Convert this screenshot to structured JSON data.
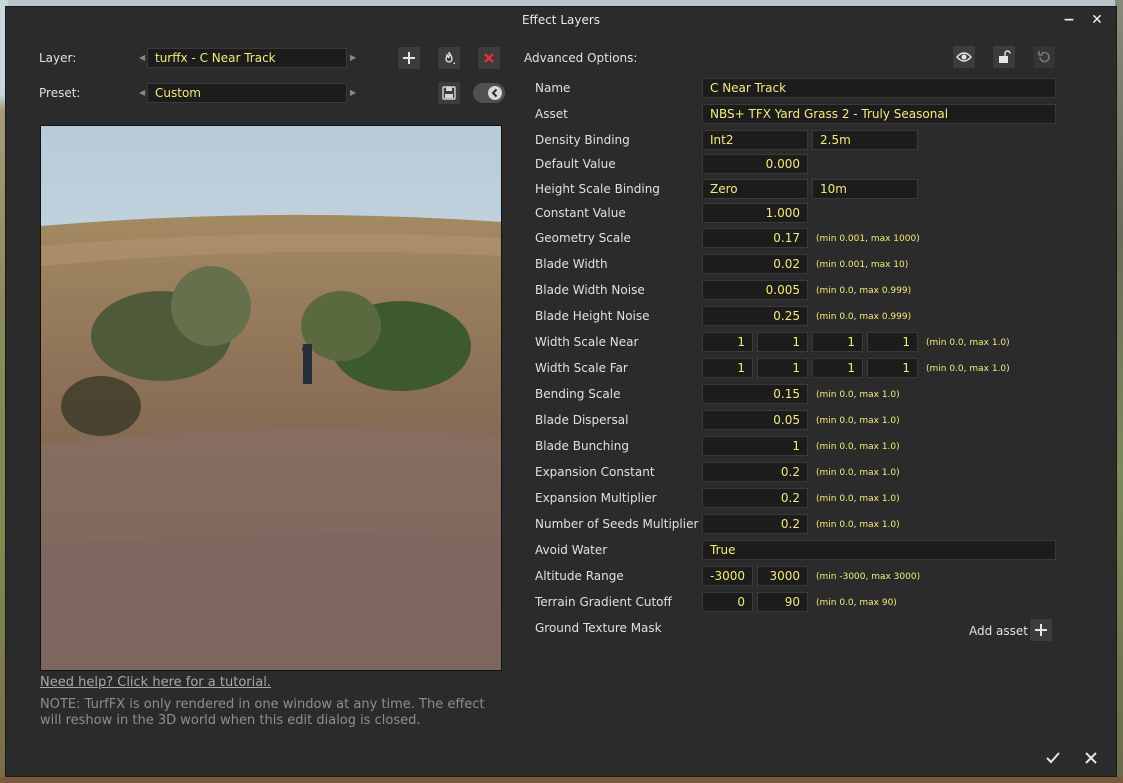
{
  "window": {
    "title": "Effect Layers",
    "minimize_glyph": "−",
    "close_glyph": "✕"
  },
  "left": {
    "layer_label": "Layer:",
    "layer_value": "turffx - C Near Track",
    "preset_label": "Preset:",
    "preset_value": "Custom",
    "help_link": "Need help? Click here for a tutorial.",
    "note": "NOTE: TurfFX is only rendered in one window at any time. The effect will reshow in the 3D world when this edit dialog is closed."
  },
  "icons": {
    "add": "plus-icon",
    "fire": "flame-icon",
    "delete": "delete-icon",
    "save": "save-icon",
    "toggle": "toggle-icon",
    "eye": "eye-icon",
    "lock": "unlock-icon",
    "undo": "undo-icon",
    "confirm": "check-icon",
    "cancel": "close-icon"
  },
  "advanced": {
    "title": "Advanced Options:",
    "name_label": "Name",
    "name_value": "C Near Track",
    "asset_label": "Asset",
    "asset_value": "NBS+ TFX Yard Grass 2 - Truly Seasonal",
    "density_label": "Density Binding",
    "density_a": "Int2",
    "density_b": "2.5m",
    "default_label": "Default Value",
    "default_value": "0.000",
    "height_label": "Height Scale Binding",
    "height_a": "Zero",
    "height_b": "10m",
    "constant_label": "Constant Value",
    "constant_value": "1.000",
    "geometry_label": "Geometry Scale",
    "geometry_value": "0.17",
    "geometry_hint": "(min 0.001, max 1000)",
    "blade_width_label": "Blade Width",
    "blade_width_value": "0.02",
    "blade_width_hint": "(min 0.001, max 10)",
    "bwn_label": "Blade Width Noise",
    "bwn_value": "0.005",
    "bwn_hint": "(min 0.0, max 0.999)",
    "bhn_label": "Blade Height Noise",
    "bhn_value": "0.25",
    "bhn_hint": "(min 0.0, max 0.999)",
    "wsn_label": "Width Scale Near",
    "wsn_values": [
      "1",
      "1",
      "1",
      "1"
    ],
    "wsn_hint": "(min 0.0, max 1.0)",
    "wsf_label": "Width Scale Far",
    "wsf_values": [
      "1",
      "1",
      "1",
      "1"
    ],
    "wsf_hint": "(min 0.0, max 1.0)",
    "bending_label": "Bending Scale",
    "bending_value": "0.15",
    "bending_hint": "(min 0.0, max 1.0)",
    "dispersal_label": "Blade Dispersal",
    "dispersal_value": "0.05",
    "dispersal_hint": "(min 0.0, max 1.0)",
    "bunching_label": "Blade Bunching",
    "bunching_value": "1",
    "bunching_hint": "(min 0.0, max 1.0)",
    "exp_const_label": "Expansion Constant",
    "exp_const_value": "0.2",
    "exp_const_hint": "(min 0.0, max 1.0)",
    "exp_mult_label": "Expansion Multiplier",
    "exp_mult_value": "0.2",
    "exp_mult_hint": "(min 0.0, max 1.0)",
    "seeds_label": "Number of Seeds Multiplier",
    "seeds_value": "0.2",
    "seeds_hint": "(min 0.0, max 1.0)",
    "avoid_label": "Avoid Water",
    "avoid_value": "True",
    "alt_label": "Altitude Range",
    "alt_min": "-3000",
    "alt_max": "3000",
    "alt_hint": "(min -3000, max 3000)",
    "grad_label": "Terrain Gradient Cutoff",
    "grad_min": "0",
    "grad_max": "90",
    "grad_hint": "(min 0.0, max 90)",
    "mask_label": "Ground Texture Mask",
    "add_asset_label": "Add asset"
  },
  "colors": {
    "value_text": "#f3ec7a",
    "panel": "#2b2b2b",
    "field": "#1c1c1c"
  }
}
